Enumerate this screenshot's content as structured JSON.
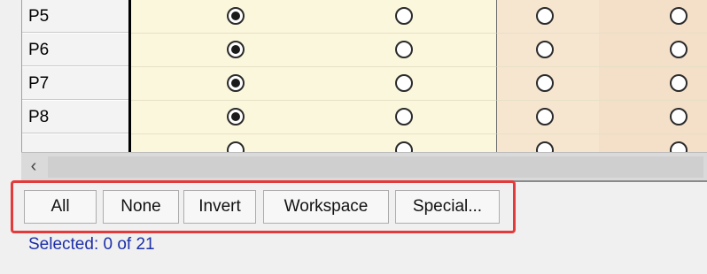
{
  "grid": {
    "rows": [
      {
        "label": "P5",
        "selection": [
          true,
          false,
          false,
          false
        ]
      },
      {
        "label": "P6",
        "selection": [
          true,
          false,
          false,
          false
        ]
      },
      {
        "label": "P7",
        "selection": [
          true,
          false,
          false,
          false
        ]
      },
      {
        "label": "P8",
        "selection": [
          true,
          false,
          false,
          false
        ]
      }
    ]
  },
  "scrollbar": {
    "left_arrow": "‹"
  },
  "toolbar": {
    "all_label": "All",
    "none_label": "None",
    "invert_label": "Invert",
    "workspace_label": "Workspace",
    "special_label": "Special..."
  },
  "status": {
    "text": "Selected: 0 of 21"
  },
  "colors": {
    "highlight": "#e33b3b",
    "status_text": "#1c2fa8"
  }
}
